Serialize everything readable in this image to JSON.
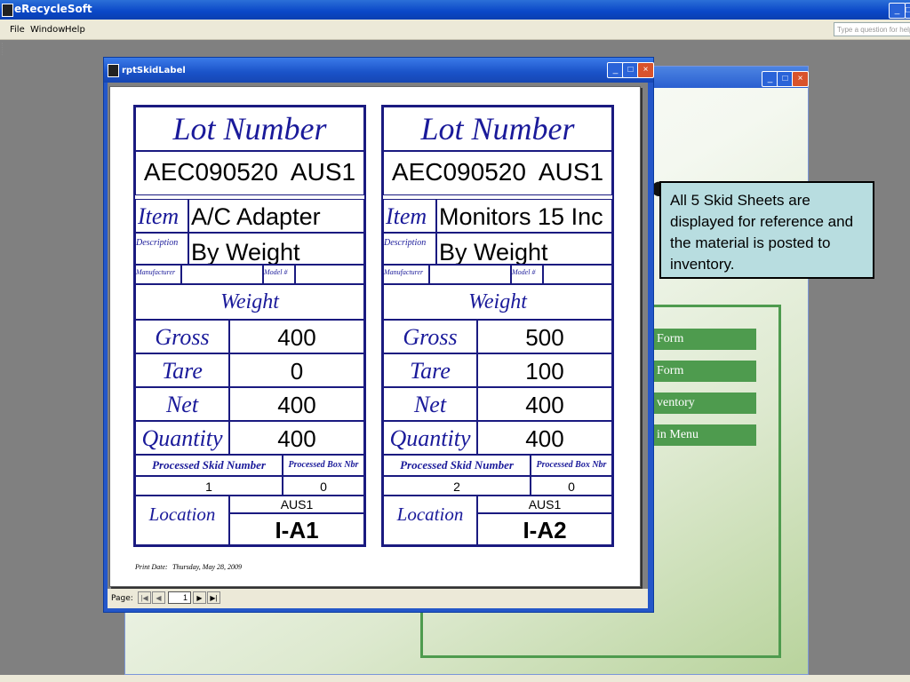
{
  "app": {
    "title": "eRecycleSoft",
    "menu": {
      "file": "File",
      "window": "Window",
      "help": "Help"
    },
    "question_placeholder": "Type a question for help"
  },
  "background_form": {
    "buttons": [
      "Form",
      "Form",
      "ventory",
      "in Menu"
    ],
    "logo_fragment": "•u",
    "registered_mark": "®"
  },
  "report_window": {
    "title": "rptSkidLabel",
    "nav": {
      "label": "Page:",
      "page": "1",
      "first": "|◀",
      "prev": "◀",
      "next": "▶",
      "last": "▶|"
    }
  },
  "labels": [
    {
      "lot_heading": "Lot Number",
      "lot_number": "AEC090520  AUS1",
      "item_label": "Item",
      "item_value": "A/C Adapter",
      "description_label": "Description",
      "description_value": "By Weight",
      "manufacturer_label": "Manufacturer",
      "model_label": "Model #",
      "weight_heading": "Weight",
      "gross_label": "Gross",
      "gross_value": "400",
      "tare_label": "Tare",
      "tare_value": "0",
      "net_label": "Net",
      "net_value": "400",
      "quantity_label": "Quantity",
      "quantity_value": "400",
      "skid_number_label": "Processed Skid Number",
      "box_number_label": "Processed Box Nbr",
      "skid_number_value": "1",
      "box_number_value": "0",
      "location_label": "Location",
      "location_site": "AUS1",
      "location_value": "I-A1"
    },
    {
      "lot_heading": "Lot Number",
      "lot_number": "AEC090520  AUS1",
      "item_label": "Item",
      "item_value": "Monitors 15 Inc",
      "description_label": "Description",
      "description_value": "By Weight",
      "manufacturer_label": "Manufacturer",
      "model_label": "Model #",
      "weight_heading": "Weight",
      "gross_label": "Gross",
      "gross_value": "500",
      "tare_label": "Tare",
      "tare_value": "100",
      "net_label": "Net",
      "net_value": "400",
      "quantity_label": "Quantity",
      "quantity_value": "400",
      "skid_number_label": "Processed Skid Number",
      "box_number_label": "Processed Box Nbr",
      "skid_number_value": "2",
      "box_number_value": "0",
      "location_label": "Location",
      "location_site": "AUS1",
      "location_value": "I-A2"
    }
  ],
  "print_date": {
    "label": "Print Date:",
    "value": "Thursday, May 28, 2009"
  },
  "callout": {
    "text": "All 5 Skid Sheets are displayed for reference and the material is posted to inventory."
  }
}
